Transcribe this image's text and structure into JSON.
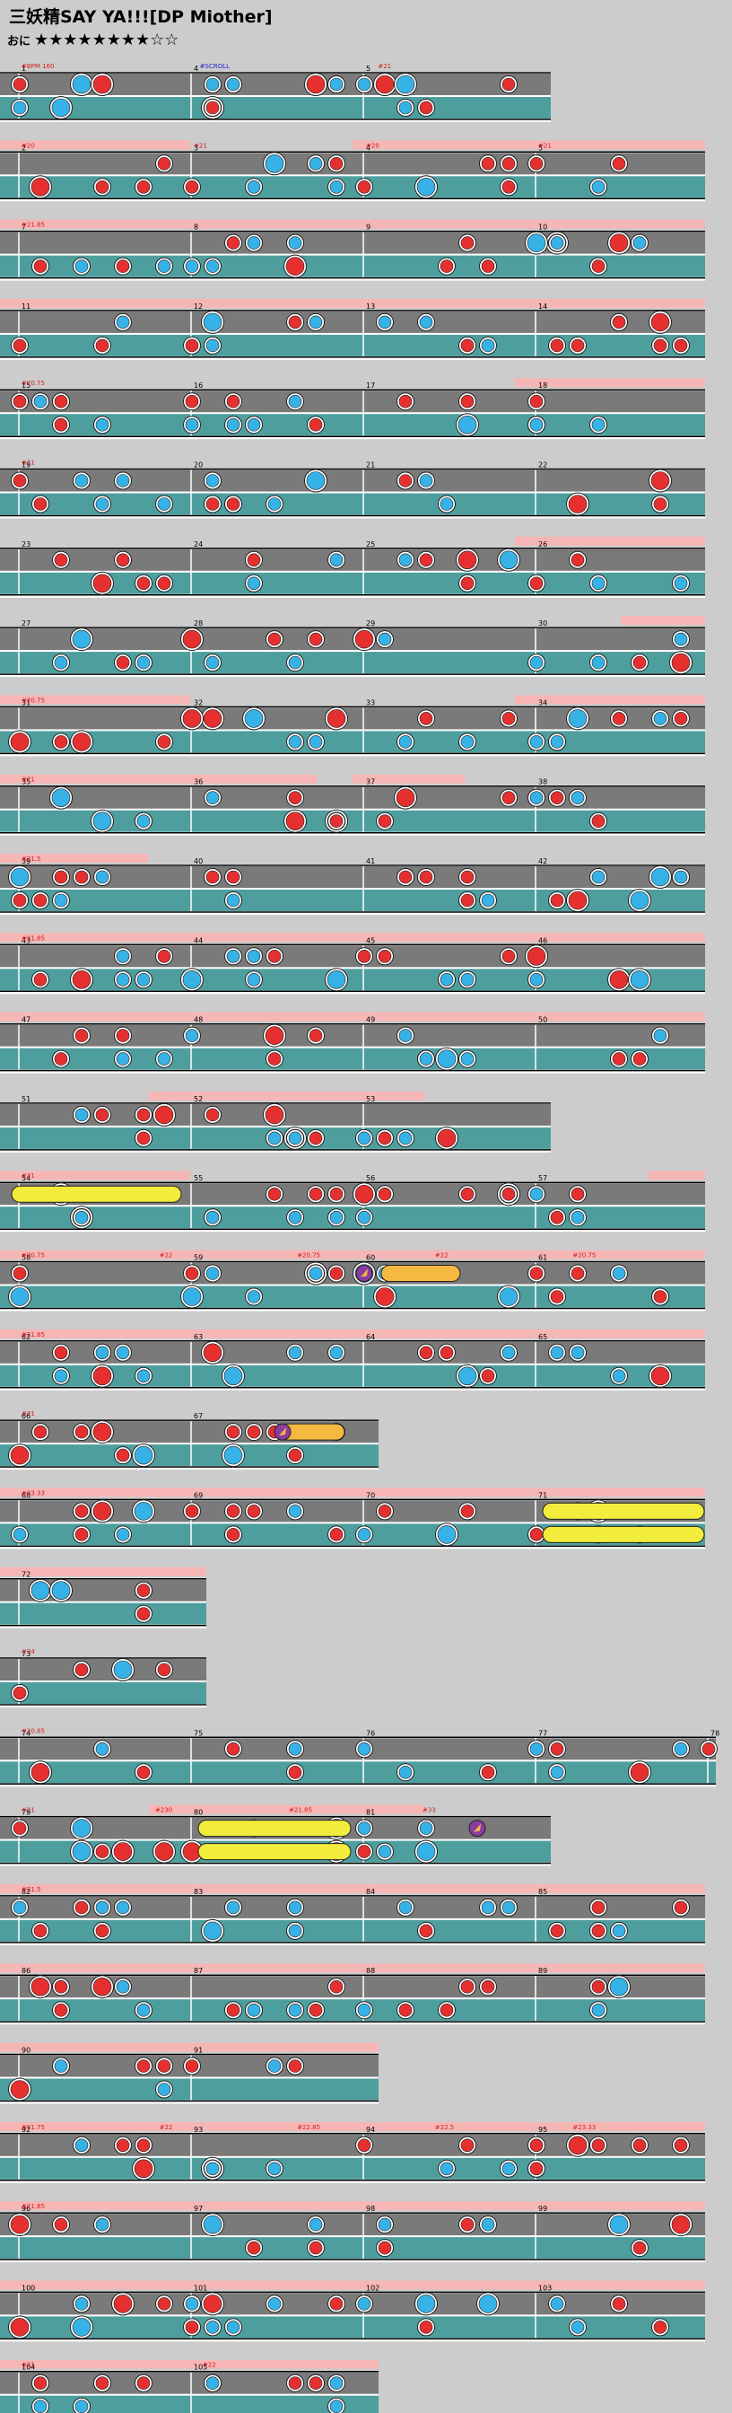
{
  "song": {
    "title": "三妖精SAY YA!!![DP Miother]",
    "difficulty_label": "おに",
    "stars": "★★★★★★★★☆☆",
    "level": 8,
    "max_level": 10
  },
  "colors": {
    "background": "#cccccc",
    "lane_gray": "#7a7a7a",
    "lane_teal": "#4f9e9e",
    "gogo_band": "#f6b6b6",
    "don": "#e63030",
    "ka": "#36b2e6",
    "roll": "#f2ec3c",
    "balloon": "#f5b840",
    "purple": "#8a3ca0",
    "bpm_text": "#d02020",
    "scroll_text": "#2020d0"
  },
  "icons": [
    "don-note",
    "ka-note",
    "big-don-note",
    "big-ka-note",
    "drumroll",
    "balloon",
    "purple-balloon-head"
  ],
  "chart_data": {
    "type": "table",
    "title": "三妖精SAY YA!!![DP Miother]",
    "subtitle": "おに ★★★★★★★★☆☆",
    "rows": [
      {
        "measures": [
          "1",
          "4",
          "5"
        ],
        "markers": [
          "#BPM 160",
          "#SCROLL",
          "#21"
        ],
        "gogo": []
      },
      {
        "measures": [
          "2",
          "3",
          "4",
          "5"
        ],
        "markers": [
          "#20",
          "#21",
          "#20",
          "#21"
        ],
        "gogo": [
          [
            0,
            0.27
          ],
          [
            0.5,
            1
          ]
        ]
      },
      {
        "measures": [
          "7",
          "8",
          "9",
          "10"
        ],
        "markers": [
          "#21.85"
        ],
        "gogo": [
          [
            0,
            1
          ]
        ]
      },
      {
        "measures": [
          "11",
          "12",
          "13",
          "14"
        ],
        "markers": [],
        "gogo": [
          [
            0,
            1
          ]
        ]
      },
      {
        "measures": [
          "15",
          "16",
          "17",
          "18"
        ],
        "markers": [
          "#20.75"
        ],
        "gogo": [
          [
            0.73,
            1
          ]
        ]
      },
      {
        "measures": [
          "19",
          "20",
          "21",
          "22"
        ],
        "markers": [
          "#21"
        ],
        "gogo": []
      },
      {
        "measures": [
          "23",
          "24",
          "25",
          "26"
        ],
        "markers": [],
        "gogo": [
          [
            0.73,
            1
          ]
        ]
      },
      {
        "measures": [
          "27",
          "28",
          "29",
          "30"
        ],
        "markers": [],
        "gogo": [
          [
            0.88,
            1
          ]
        ]
      },
      {
        "measures": [
          "31",
          "32",
          "33",
          "34"
        ],
        "markers": [
          "#20.75"
        ],
        "gogo": [
          [
            0,
            0.27
          ],
          [
            0.73,
            1
          ]
        ]
      },
      {
        "measures": [
          "35",
          "36",
          "37",
          "38"
        ],
        "markers": [
          "#21"
        ],
        "gogo": [
          [
            0,
            0.45
          ],
          [
            0.5,
            0.66
          ]
        ]
      },
      {
        "measures": [
          "39",
          "40",
          "41",
          "42"
        ],
        "markers": [
          "#21.5"
        ],
        "gogo": [
          [
            0,
            0.21
          ]
        ]
      },
      {
        "measures": [
          "43",
          "44",
          "45",
          "46"
        ],
        "markers": [
          "#21.85"
        ],
        "gogo": [
          [
            0,
            1
          ]
        ]
      },
      {
        "measures": [
          "47",
          "48",
          "49",
          "50"
        ],
        "markers": [],
        "gogo": [
          [
            0,
            1
          ]
        ]
      },
      {
        "measures": [
          "51",
          "52",
          "53"
        ],
        "markers": [],
        "gogo": [
          [
            0.27,
            0.77
          ]
        ]
      },
      {
        "measures": [
          "54",
          "55",
          "56",
          "57"
        ],
        "markers": [
          "#21"
        ],
        "gogo": [
          [
            0,
            0.27
          ],
          [
            0.92,
            1
          ]
        ]
      },
      {
        "measures": [
          "58",
          "59",
          "60",
          "61"
        ],
        "markers": [
          "#20.75",
          "#22",
          "#20.75",
          "#22",
          "#20.75"
        ],
        "gogo": [
          [
            0,
            1
          ]
        ]
      },
      {
        "measures": [
          "62",
          "63",
          "64",
          "65"
        ],
        "markers": [
          "#21.85"
        ],
        "gogo": [
          [
            0,
            1
          ]
        ]
      },
      {
        "measures": [
          "66",
          "67"
        ],
        "markers": [
          "#21"
        ],
        "gogo": []
      },
      {
        "measures": [
          "68",
          "69",
          "70",
          "71"
        ],
        "markers": [
          "#23.33"
        ],
        "gogo": [
          [
            0,
            1
          ]
        ]
      },
      {
        "measures": [
          "72"
        ],
        "markers": [],
        "gogo": [
          [
            0,
            1
          ]
        ]
      },
      {
        "measures": [
          "73"
        ],
        "markers": [
          "#24"
        ],
        "gogo": []
      },
      {
        "measures": [
          "74",
          "75",
          "76",
          "77",
          "78"
        ],
        "markers": [
          "#20.85"
        ],
        "gogo": []
      },
      {
        "measures": [
          "79",
          "80",
          "81"
        ],
        "markers": [
          "#21",
          "#230",
          "#21.85",
          "#33"
        ],
        "gogo": [
          [
            0.27,
            0.77
          ]
        ]
      },
      {
        "measures": [
          "82",
          "83",
          "84",
          "85"
        ],
        "markers": [
          "#21.5"
        ],
        "gogo": [
          [
            0,
            1
          ]
        ]
      },
      {
        "measures": [
          "86",
          "87",
          "88",
          "89"
        ],
        "markers": [],
        "gogo": [
          [
            0,
            1
          ]
        ]
      },
      {
        "measures": [
          "90",
          "91"
        ],
        "markers": [],
        "gogo": [
          [
            0,
            1
          ]
        ]
      },
      {
        "measures": [
          "92",
          "93",
          "94",
          "95"
        ],
        "markers": [
          "#21.75",
          "#22",
          "#22.85",
          "#22.5",
          "#23.33"
        ],
        "gogo": [
          [
            0,
            1
          ]
        ]
      },
      {
        "measures": [
          "96",
          "97",
          "98",
          "99"
        ],
        "markers": [
          "#21.85"
        ],
        "gogo": [
          [
            0,
            1
          ]
        ]
      },
      {
        "measures": [
          "100",
          "101",
          "102",
          "103"
        ],
        "markers": [],
        "gogo": [
          [
            0,
            1
          ]
        ]
      },
      {
        "measures": [
          "104",
          "105"
        ],
        "markers": [
          "#21",
          "#22"
        ],
        "gogo": [
          [
            0,
            1
          ]
        ]
      }
    ],
    "legend": [
      "don",
      "ka",
      "big-don",
      "big-ka",
      "drumroll",
      "balloon"
    ]
  }
}
